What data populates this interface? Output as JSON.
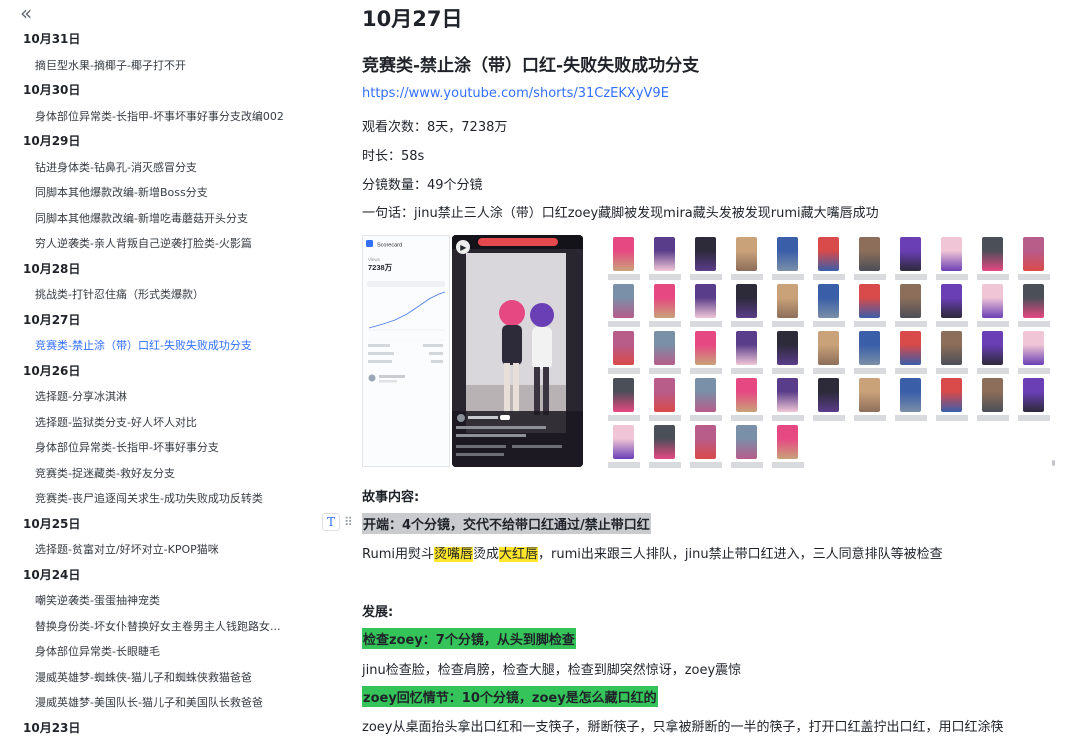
{
  "sidebar": {
    "collapse_icon": "«",
    "sections": [
      {
        "date": "10月31日",
        "items": [
          {
            "label": "摘巨型水果-摘椰子-椰子打不开"
          }
        ]
      },
      {
        "date": "10月30日",
        "items": [
          {
            "label": "身体部位异常类-长指甲-坏事坏事好事分支改编002"
          }
        ]
      },
      {
        "date": "10月29日",
        "items": [
          {
            "label": "钻进身体类-钻鼻孔-消灭感冒分支"
          },
          {
            "label": "同脚本其他爆款改编-新增Boss分支"
          },
          {
            "label": "同脚本其他爆款改编-新增吃毒蘑菇开头分支"
          },
          {
            "label": "穷人逆袭类-亲人背叛自己逆袭打脸类-火影篇"
          }
        ]
      },
      {
        "date": "10月28日",
        "items": [
          {
            "label": "挑战类-打针忍住痛（形式类爆款）"
          }
        ]
      },
      {
        "date": "10月27日",
        "items": [
          {
            "label": "竞赛类-禁止涂（带）口红-失败失败成功分支",
            "active": true
          }
        ]
      },
      {
        "date": "10月26日",
        "items": [
          {
            "label": "选择题-分享冰淇淋"
          },
          {
            "label": "选择题-监狱类分支-好人坏人对比"
          },
          {
            "label": "身体部位异常类-长指甲-坏事好事分支"
          },
          {
            "label": "竞赛类-捉迷藏类-救好友分支"
          },
          {
            "label": "竞赛类-丧尸追逐闯关求生-成功失败成功反转类"
          }
        ]
      },
      {
        "date": "10月25日",
        "items": [
          {
            "label": "选择题-贫富对立/好坏对立-KPOP猫咪"
          }
        ]
      },
      {
        "date": "10月24日",
        "items": [
          {
            "label": "嘲笑逆袭类-蛋蛋抽神宠类"
          },
          {
            "label": "替换身份类-坏女仆替换好女主卷男主人钱跑路女..."
          },
          {
            "label": "身体部位异常类-长眼睫毛"
          },
          {
            "label": "漫威英雄梦-蜘蛛侠-猫儿子和蜘蛛侠救猫爸爸"
          },
          {
            "label": "漫威英雄梦-美国队长-猫儿子和美国队长救爸爸"
          }
        ]
      },
      {
        "date": "10月23日",
        "items": []
      }
    ]
  },
  "doc": {
    "date_title": "10月27日",
    "title": "竞赛类-禁止涂（带）口红-失败失败成功分支",
    "link": "https://www.youtube.com/shorts/31CzEKXyV9E",
    "views_label": "观看次数：",
    "views_value": "8天，7238万",
    "duration_label": "时长：",
    "duration_value": "58s",
    "shots_label": "分镜数量：",
    "shots_value": "49个分镜",
    "summary_label": "一句话：",
    "summary_value": "jinu禁止三人涂（带）口红zoey藏脚被发现mira藏头发被发现rumi藏大嘴唇成功",
    "story_heading": "故事内容:",
    "opening_heading": "开端：4个分镜，交代不给带口红通过/禁止带口红",
    "opening_text": {
      "p1": "Rumi用熨斗",
      "h1": "烫嘴唇",
      "p2": "烫成",
      "h2": "大红唇",
      "p3": "，rumi出来跟三人排队，jinu禁止带口红进入，三人同意排队等被检查"
    },
    "dev_heading": "发展:",
    "check_heading": "检查zoey：7个分镜，从头到脚检查",
    "check_text": "jinu检查脸，检查肩膀，检查大腿，检查到脚突然惊讶，zoey震惊",
    "flash_heading": "zoey回忆情节：10个分镜，zoey是怎么藏口红的",
    "flash_text": "zoey从桌面抬头拿出口红和一支筷子，掰断筷子，只拿被掰断的一半的筷子，打开口红盖拧出口红，用口红涂筷"
  },
  "analytics_card": {
    "app": "Scorecard",
    "views_caption": "Views",
    "views_value": "7238万"
  },
  "icons": {
    "block_type": "T",
    "drag": "⠿",
    "play": "▶"
  },
  "colors": {
    "accent": "#3370ff",
    "highlight_gray": "#c9cbcf",
    "highlight_green": "#35c45a",
    "highlight_yellow": "#ffe52c"
  }
}
